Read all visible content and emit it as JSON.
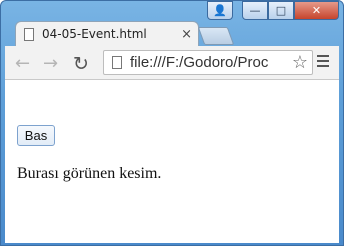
{
  "tab": {
    "title": "04-05-Event.html",
    "close": "×"
  },
  "toolbar": {
    "url": "file:///F:/Godoro/Proc",
    "back": "←",
    "forward": "→",
    "reload": "↻",
    "star": "☆"
  },
  "window_controls": {
    "minimize": "—",
    "maximize": "□",
    "close": "✕"
  },
  "content": {
    "button_label": "Bas",
    "paragraph": "Burası görünen kesim."
  }
}
